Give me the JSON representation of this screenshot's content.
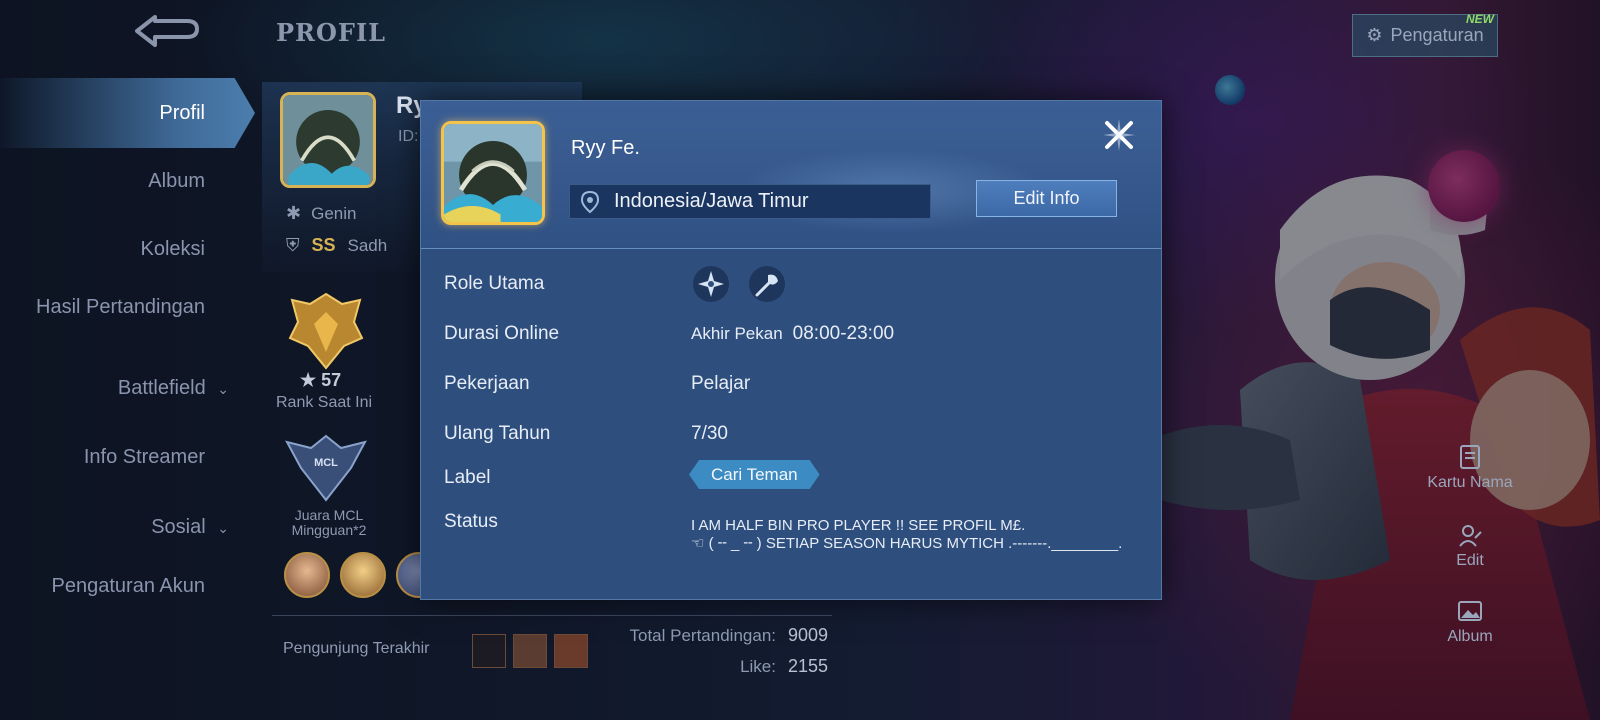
{
  "page": {
    "title": "PROFIL"
  },
  "sidebar": {
    "items": [
      {
        "label": "Profil",
        "active": true
      },
      {
        "label": "Album"
      },
      {
        "label": "Koleksi"
      },
      {
        "label": "Hasil Pertandingan"
      },
      {
        "label": "Battlefield",
        "expandable": true
      },
      {
        "label": "Info Streamer"
      },
      {
        "label": "Sosial",
        "expandable": true
      },
      {
        "label": "Pengaturan Akun"
      }
    ]
  },
  "background_profile": {
    "name_partial": "Ry",
    "id_partial": "ID:",
    "rank_tier": "Genin",
    "badge": "SS",
    "badge_text_partial": "Sadh",
    "rank_stars": "57",
    "rank_label": "Rank Saat Ini",
    "mcl_label": "Juara MCL Mingguan*2",
    "visitors_label": "Pengunjung Terakhir",
    "total_matches_label": "Total Pertandingan:",
    "total_matches_value": "9009",
    "like_label": "Like:",
    "like_value": "2155"
  },
  "top_right": {
    "settings_label": "Pengaturan",
    "new_badge": "NEW"
  },
  "side_actions": {
    "name_card": "Kartu Nama",
    "edit": "Edit",
    "album": "Album"
  },
  "modal": {
    "name": "Ryy Fe.",
    "location": "Indonesia/Jawa Timur",
    "edit_button": "Edit Info",
    "rows": {
      "role_label": "Role Utama",
      "roles": [
        "assassin-icon",
        "support-icon"
      ],
      "online_label": "Durasi Online",
      "online_day": "Akhir Pekan",
      "online_time": "08:00-23:00",
      "job_label": "Pekerjaan",
      "job_value": "Pelajar",
      "birthday_label": "Ulang Tahun",
      "birthday_value": "7/30",
      "tag_label": "Label",
      "tag_value": "Cari Teman",
      "status_label": "Status",
      "status_value": "I AM HALF BIN PRO PLAYER !!   SEE PROFIL M£.\n   ☜ ( ╌ _ ╌ )     SETIAP SEASON HARUS MYTICH .-------.________."
    }
  },
  "colors": {
    "modal_bg": "#2e4e7d",
    "accent_gold": "#f3c34a",
    "tag_blue": "#3c8bc3",
    "new_green": "#8fd96a"
  }
}
